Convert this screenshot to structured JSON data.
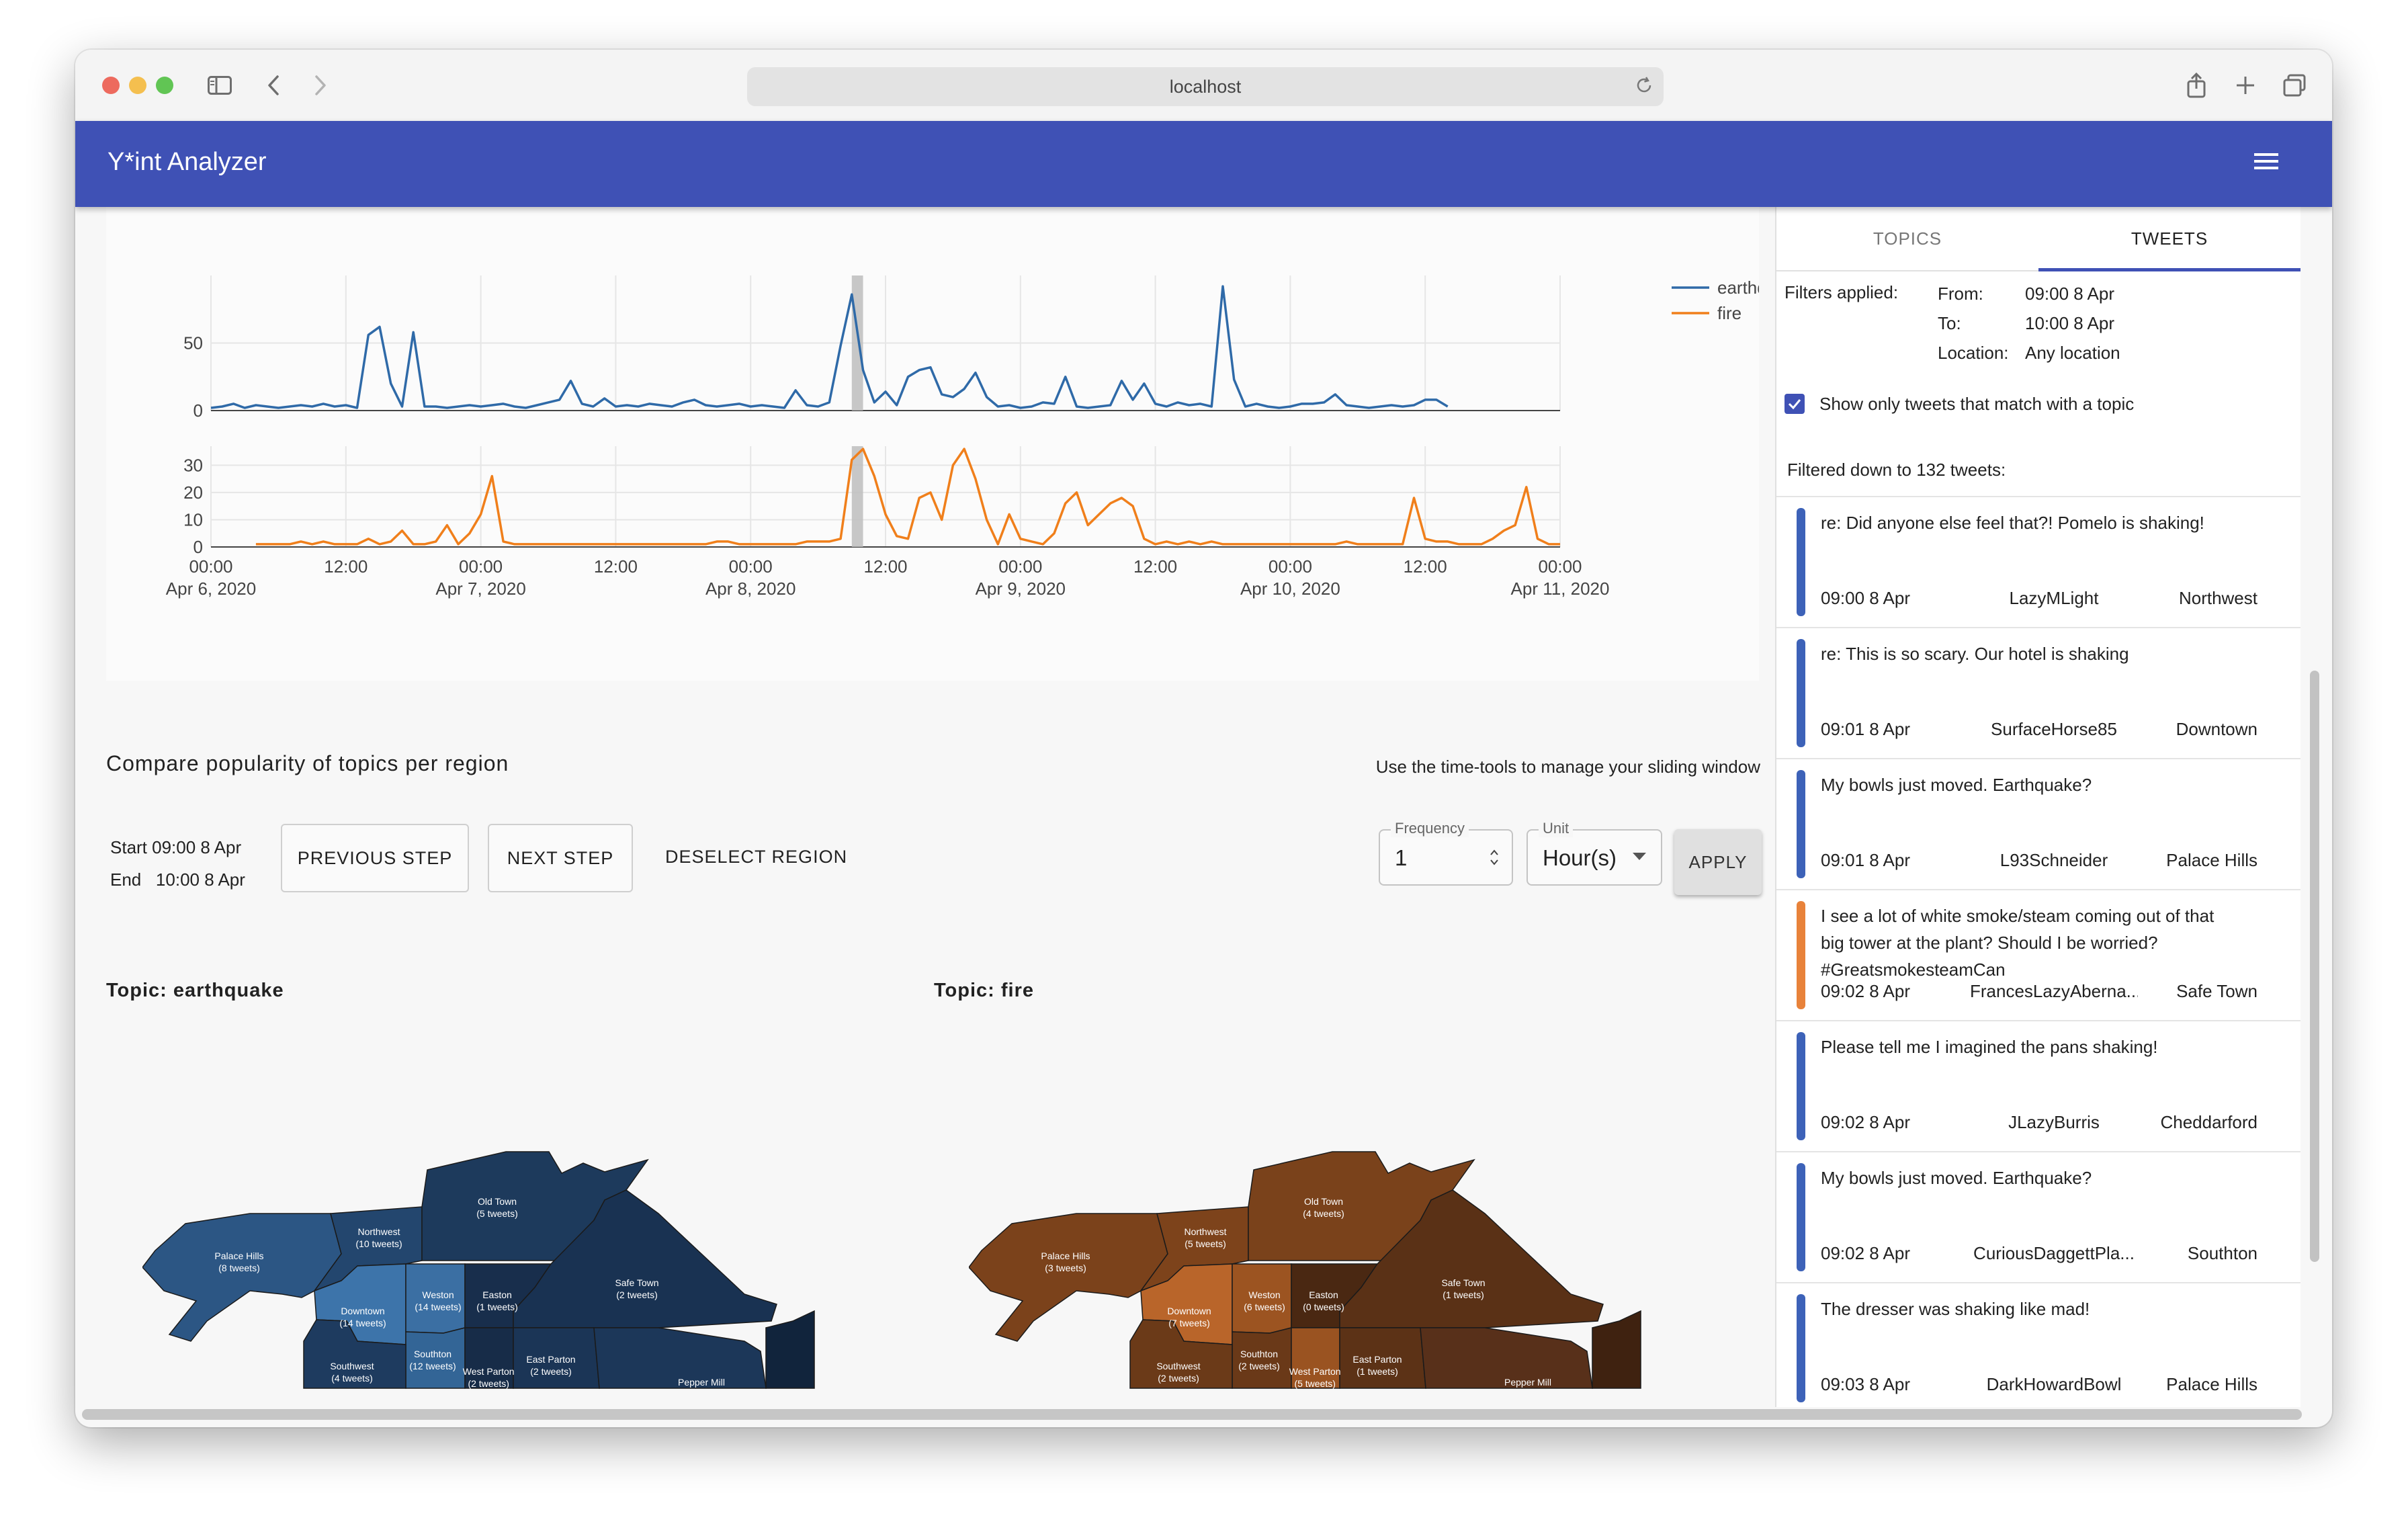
{
  "browser": {
    "address": "localhost"
  },
  "app": {
    "title": "Y*int Analyzer"
  },
  "chart_data": [
    {
      "type": "line",
      "series": [
        {
          "name": "earthquake",
          "color": "#2f6aa8"
        }
      ],
      "x_labels": [
        "00:00",
        "12:00",
        "00:00",
        "12:00",
        "00:00",
        "12:00",
        "00:00",
        "12:00",
        "00:00",
        "12:00",
        "00:00"
      ],
      "x_sublabels": [
        "Apr 6, 2020",
        "",
        "Apr 7, 2020",
        "",
        "Apr 8, 2020",
        "",
        "Apr 9, 2020",
        "",
        "Apr 10, 2020",
        "",
        "Apr 11, 2020"
      ],
      "x_range_hours": [
        0,
        120
      ],
      "y_ticks": [
        "0",
        "50"
      ],
      "ylim": [
        0,
        100
      ],
      "points": [
        [
          0,
          2
        ],
        [
          1,
          3
        ],
        [
          2,
          5
        ],
        [
          3,
          2
        ],
        [
          4,
          4
        ],
        [
          5,
          3
        ],
        [
          6,
          2
        ],
        [
          7,
          3
        ],
        [
          8,
          4
        ],
        [
          9,
          3
        ],
        [
          10,
          5
        ],
        [
          11,
          3
        ],
        [
          12,
          4
        ],
        [
          13,
          2
        ],
        [
          14,
          56
        ],
        [
          15,
          62
        ],
        [
          16,
          20
        ],
        [
          17,
          3
        ],
        [
          18,
          58
        ],
        [
          19,
          3
        ],
        [
          20,
          3
        ],
        [
          21,
          2
        ],
        [
          22,
          3
        ],
        [
          23,
          4
        ],
        [
          24,
          3
        ],
        [
          25,
          4
        ],
        [
          26,
          5
        ],
        [
          27,
          3
        ],
        [
          28,
          2
        ],
        [
          29,
          4
        ],
        [
          30,
          6
        ],
        [
          31,
          8
        ],
        [
          32,
          22
        ],
        [
          33,
          5
        ],
        [
          34,
          3
        ],
        [
          35,
          9
        ],
        [
          36,
          3
        ],
        [
          37,
          4
        ],
        [
          38,
          3
        ],
        [
          39,
          5
        ],
        [
          40,
          4
        ],
        [
          41,
          3
        ],
        [
          42,
          6
        ],
        [
          43,
          8
        ],
        [
          44,
          4
        ],
        [
          45,
          3
        ],
        [
          46,
          4
        ],
        [
          47,
          5
        ],
        [
          48,
          3
        ],
        [
          49,
          4
        ],
        [
          50,
          3
        ],
        [
          51,
          2
        ],
        [
          52,
          15
        ],
        [
          53,
          4
        ],
        [
          54,
          3
        ],
        [
          55,
          6
        ],
        [
          56,
          48
        ],
        [
          57,
          86
        ],
        [
          58,
          30
        ],
        [
          59,
          6
        ],
        [
          60,
          14
        ],
        [
          61,
          4
        ],
        [
          62,
          25
        ],
        [
          63,
          30
        ],
        [
          64,
          32
        ],
        [
          65,
          12
        ],
        [
          66,
          10
        ],
        [
          67,
          16
        ],
        [
          68,
          28
        ],
        [
          69,
          10
        ],
        [
          70,
          3
        ],
        [
          71,
          4
        ],
        [
          72,
          2
        ],
        [
          73,
          3
        ],
        [
          74,
          6
        ],
        [
          75,
          5
        ],
        [
          76,
          25
        ],
        [
          77,
          3
        ],
        [
          78,
          2
        ],
        [
          79,
          3
        ],
        [
          80,
          4
        ],
        [
          81,
          22
        ],
        [
          82,
          8
        ],
        [
          83,
          20
        ],
        [
          84,
          5
        ],
        [
          85,
          3
        ],
        [
          86,
          6
        ],
        [
          87,
          4
        ],
        [
          88,
          5
        ],
        [
          89,
          3
        ],
        [
          90,
          92
        ],
        [
          91,
          23
        ],
        [
          92,
          3
        ],
        [
          93,
          5
        ],
        [
          94,
          3
        ],
        [
          95,
          2
        ],
        [
          96,
          3
        ],
        [
          97,
          5
        ],
        [
          98,
          5
        ],
        [
          99,
          6
        ],
        [
          100,
          12
        ],
        [
          101,
          4
        ],
        [
          102,
          3
        ],
        [
          103,
          2
        ],
        [
          104,
          3
        ],
        [
          105,
          4
        ],
        [
          106,
          3
        ],
        [
          107,
          4
        ],
        [
          108,
          8
        ],
        [
          109,
          8
        ],
        [
          110,
          3
        ]
      ],
      "highlight_hours": [
        57,
        58
      ]
    },
    {
      "type": "line",
      "series": [
        {
          "name": "fire",
          "color": "#f07f1b"
        }
      ],
      "x_labels": [
        "00:00",
        "12:00",
        "00:00",
        "12:00",
        "00:00",
        "12:00",
        "00:00",
        "12:00",
        "00:00",
        "12:00",
        "00:00"
      ],
      "x_sublabels": [
        "Apr 6, 2020",
        "",
        "Apr 7, 2020",
        "",
        "Apr 8, 2020",
        "",
        "Apr 9, 2020",
        "",
        "Apr 10, 2020",
        "",
        "Apr 11, 2020"
      ],
      "x_range_hours": [
        0,
        120
      ],
      "y_ticks": [
        "0",
        "10",
        "20",
        "30"
      ],
      "ylim": [
        0,
        37
      ],
      "points": [
        [
          4,
          1
        ],
        [
          5,
          1
        ],
        [
          6,
          1
        ],
        [
          7,
          1
        ],
        [
          8,
          2
        ],
        [
          9,
          1
        ],
        [
          10,
          2
        ],
        [
          11,
          1
        ],
        [
          12,
          1
        ],
        [
          13,
          1
        ],
        [
          14,
          3
        ],
        [
          15,
          1
        ],
        [
          16,
          2
        ],
        [
          17,
          6
        ],
        [
          18,
          1
        ],
        [
          19,
          1
        ],
        [
          20,
          2
        ],
        [
          21,
          8
        ],
        [
          22,
          1
        ],
        [
          23,
          5
        ],
        [
          24,
          12
        ],
        [
          25,
          26
        ],
        [
          26,
          2
        ],
        [
          27,
          1
        ],
        [
          28,
          1
        ],
        [
          29,
          1
        ],
        [
          30,
          1
        ],
        [
          31,
          1
        ],
        [
          32,
          1
        ],
        [
          33,
          1
        ],
        [
          34,
          1
        ],
        [
          35,
          1
        ],
        [
          36,
          1
        ],
        [
          37,
          1
        ],
        [
          38,
          1
        ],
        [
          39,
          1
        ],
        [
          40,
          1
        ],
        [
          41,
          1
        ],
        [
          42,
          1
        ],
        [
          43,
          1
        ],
        [
          44,
          1
        ],
        [
          45,
          2
        ],
        [
          46,
          2
        ],
        [
          47,
          1
        ],
        [
          48,
          1
        ],
        [
          49,
          1
        ],
        [
          50,
          1
        ],
        [
          51,
          1
        ],
        [
          52,
          1
        ],
        [
          53,
          2
        ],
        [
          54,
          2
        ],
        [
          55,
          2
        ],
        [
          56,
          3
        ],
        [
          57,
          32
        ],
        [
          58,
          36
        ],
        [
          59,
          26
        ],
        [
          60,
          12
        ],
        [
          61,
          4
        ],
        [
          62,
          3
        ],
        [
          63,
          18
        ],
        [
          64,
          20
        ],
        [
          65,
          10
        ],
        [
          66,
          30
        ],
        [
          67,
          36
        ],
        [
          68,
          25
        ],
        [
          69,
          10
        ],
        [
          70,
          1
        ],
        [
          71,
          12
        ],
        [
          72,
          3
        ],
        [
          73,
          2
        ],
        [
          74,
          1
        ],
        [
          75,
          5
        ],
        [
          76,
          16
        ],
        [
          77,
          20
        ],
        [
          78,
          8
        ],
        [
          79,
          12
        ],
        [
          80,
          16
        ],
        [
          81,
          18
        ],
        [
          82,
          15
        ],
        [
          83,
          3
        ],
        [
          84,
          1
        ],
        [
          85,
          2
        ],
        [
          86,
          1
        ],
        [
          87,
          2
        ],
        [
          88,
          1
        ],
        [
          89,
          2
        ],
        [
          90,
          1
        ],
        [
          91,
          1
        ],
        [
          92,
          1
        ],
        [
          93,
          1
        ],
        [
          94,
          1
        ],
        [
          95,
          1
        ],
        [
          96,
          1
        ],
        [
          97,
          1
        ],
        [
          98,
          1
        ],
        [
          99,
          1
        ],
        [
          100,
          1
        ],
        [
          101,
          2
        ],
        [
          102,
          1
        ],
        [
          103,
          1
        ],
        [
          104,
          1
        ],
        [
          105,
          1
        ],
        [
          106,
          1
        ],
        [
          107,
          18
        ],
        [
          108,
          3
        ],
        [
          109,
          2
        ],
        [
          110,
          2
        ],
        [
          111,
          1
        ],
        [
          112,
          1
        ],
        [
          113,
          1
        ],
        [
          114,
          3
        ],
        [
          115,
          6
        ],
        [
          116,
          8
        ],
        [
          117,
          22
        ],
        [
          118,
          3
        ],
        [
          119,
          1
        ],
        [
          120,
          1
        ]
      ],
      "highlight_hours": [
        57,
        58
      ]
    }
  ],
  "legend": [
    {
      "name": "earthquake",
      "color": "#2f6aa8"
    },
    {
      "name": "fire",
      "color": "#f07f1b"
    }
  ],
  "compare": {
    "title": "Compare popularity of topics per region",
    "hint": "Use the time-tools to manage your sliding window",
    "start": "Start 09:00 8 Apr",
    "end": "End   10:00 8 Apr",
    "previous_label": "PREVIOUS STEP",
    "next_label": "NEXT STEP",
    "deselect_label": "DESELECT REGION",
    "frequency_label": "Frequency",
    "frequency_value": "1",
    "unit_label": "Unit",
    "unit_value": "Hour(s)",
    "apply_label": "APPLY"
  },
  "maps": [
    {
      "topic_label": "Topic: earthquake",
      "regions": [
        {
          "name": "Palace Hills",
          "count": "(8 tweets)",
          "color": "#2c5684"
        },
        {
          "name": "Northwest",
          "count": "(10 tweets)",
          "color": "#23466e"
        },
        {
          "name": "Old Town",
          "count": "(5 tweets)",
          "color": "#1d3a5c"
        },
        {
          "name": "Downtown",
          "count": "(14 tweets)",
          "color": "#3d74aa"
        },
        {
          "name": "Weston",
          "count": "(14 tweets)",
          "color": "#3b6fa3"
        },
        {
          "name": "Easton",
          "count": "(1 tweets)",
          "color": "#182e4c"
        },
        {
          "name": "Safe Town",
          "count": "(2 tweets)",
          "color": "#193252"
        },
        {
          "name": "Southton",
          "count": "(12 tweets)",
          "color": "#336596"
        },
        {
          "name": "Southwest",
          "count": "(4 tweets)",
          "color": "#1e3b5f"
        },
        {
          "name": "West Parton",
          "count": "(2 tweets)",
          "color": "#172c48"
        },
        {
          "name": "East Parton",
          "count": "(2 tweets)",
          "color": "#1b3556"
        },
        {
          "name": "Pepper Mill",
          "count": "",
          "color": "#1c3759"
        },
        {
          "name": "",
          "count": "",
          "color": "#11243c"
        }
      ]
    },
    {
      "topic_label": "Topic: fire",
      "regions": [
        {
          "name": "Palace Hills",
          "count": "(3 tweets)",
          "color": "#7b421b"
        },
        {
          "name": "Northwest",
          "count": "(5 tweets)",
          "color": "#7d431b"
        },
        {
          "name": "Old Town",
          "count": "(4 tweets)",
          "color": "#7a421b"
        },
        {
          "name": "Downtown",
          "count": "(7 tweets)",
          "color": "#b9652a"
        },
        {
          "name": "Weston",
          "count": "(6 tweets)",
          "color": "#9c5421"
        },
        {
          "name": "Easton",
          "count": "(0 tweets)",
          "color": "#4a2812"
        },
        {
          "name": "Safe Town",
          "count": "(1 tweets)",
          "color": "#5a3116"
        },
        {
          "name": "Southton",
          "count": "(2 tweets)",
          "color": "#6a3918"
        },
        {
          "name": "Southwest",
          "count": "(2 tweets)",
          "color": "#6b3a18"
        },
        {
          "name": "West Parton",
          "count": "(5 tweets)",
          "color": "#9a5321"
        },
        {
          "name": "East Parton",
          "count": "(1 tweets)",
          "color": "#5c3216"
        },
        {
          "name": "Pepper Mill",
          "count": "",
          "color": "#58301a"
        },
        {
          "name": "",
          "count": "",
          "color": "#3f2210"
        }
      ]
    }
  ],
  "panel": {
    "tabs": [
      {
        "label": "TOPICS",
        "active": false
      },
      {
        "label": "TWEETS",
        "active": true
      }
    ],
    "filters_label": "Filters applied:",
    "from_label": "From:",
    "from_value": "09:00 8 Apr",
    "to_label": "To:",
    "to_value": "10:00 8 Apr",
    "location_label": "Location:",
    "location_value": "Any location",
    "checkbox_label": "Show only tweets that match with a topic",
    "checkbox_checked": true,
    "filtered_text": "Filtered down to 132 tweets:",
    "tweets": [
      {
        "text": "re: Did anyone else feel that?! Pomelo is shaking!",
        "time": "09:00 8 Apr",
        "user": "LazyMLight",
        "location": "Northwest",
        "color": "#3d62b8"
      },
      {
        "text": "re: This is so scary. Our hotel is shaking",
        "time": "09:01 8 Apr",
        "user": "SurfaceHorse85",
        "location": "Downtown",
        "color": "#3d62b8"
      },
      {
        "text": "My bowls just moved. Earthquake?",
        "time": "09:01 8 Apr",
        "user": "L93Schneider",
        "location": "Palace Hills",
        "color": "#3d62b8"
      },
      {
        "text": "I see a lot of white smoke/steam coming out of that big tower at the plant? Should I be worried? #GreatsmokesteamCan",
        "time": "09:02 8 Apr",
        "user": "FrancesLazyAberna...",
        "location": "Safe Town",
        "color": "#e8823a"
      },
      {
        "text": "Please tell me I imagined the pans shaking!",
        "time": "09:02 8 Apr",
        "user": "JLazyBurris",
        "location": "Cheddarford",
        "color": "#3d62b8"
      },
      {
        "text": "My bowls just moved. Earthquake?",
        "time": "09:02 8 Apr",
        "user": "CuriousDaggettPla...",
        "location": "Southton",
        "color": "#3d62b8"
      },
      {
        "text": "The dresser was shaking like mad!",
        "time": "09:03 8 Apr",
        "user": "DarkHowardBowl",
        "location": "Palace Hills",
        "color": "#3d62b8"
      }
    ]
  }
}
